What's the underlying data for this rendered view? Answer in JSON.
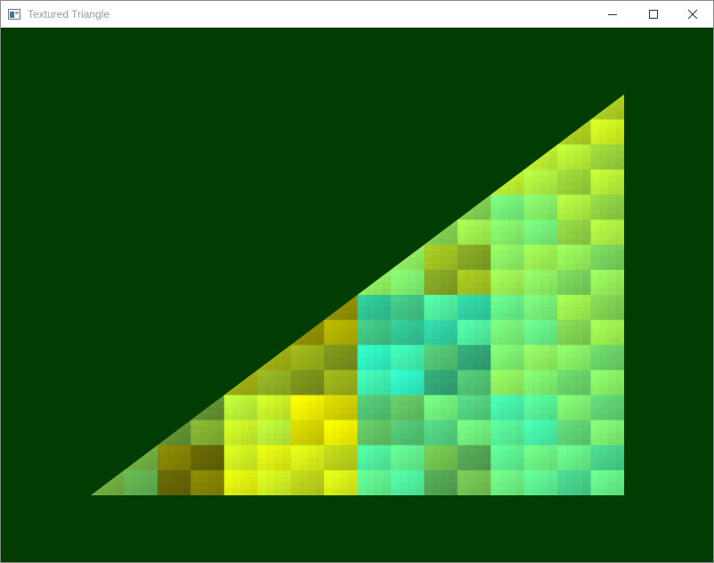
{
  "window": {
    "title": "Textured Triangle",
    "app_icon": "window-app-icon",
    "controls": {
      "minimize": "minimize-icon",
      "maximize": "maximize-icon",
      "close": "close-icon"
    }
  },
  "scene": {
    "clear_color": "#013d02",
    "texture_colors": [
      "#00ffff",
      "#7fff7f",
      "#ffff00",
      "#0a0a0a"
    ]
  }
}
